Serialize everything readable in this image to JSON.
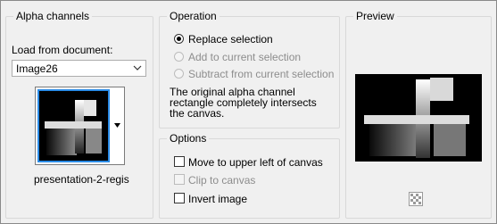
{
  "alpha_group": {
    "title": "Alpha channels",
    "load_label": "Load from document:",
    "document_value": "Image26",
    "channel_name": "presentation-2-regis"
  },
  "operation_group": {
    "title": "Operation",
    "options": [
      {
        "label": "Replace selection",
        "selected": true,
        "enabled": true
      },
      {
        "label": "Add to current selection",
        "selected": false,
        "enabled": false
      },
      {
        "label": "Subtract from current selection",
        "selected": false,
        "enabled": false
      }
    ],
    "description": "The original alpha channel rectangle completely intersects the canvas."
  },
  "options_group": {
    "title": "Options",
    "items": [
      {
        "label": "Move to upper left of canvas",
        "checked": false,
        "enabled": true
      },
      {
        "label": "Clip to canvas",
        "checked": false,
        "enabled": false
      },
      {
        "label": "Invert image",
        "checked": false,
        "enabled": true
      }
    ]
  },
  "preview_group": {
    "title": "Preview",
    "zoom_icon": "checkerboard-zoom-icon"
  },
  "colors": {
    "selection_border": "#2a8be6",
    "group_border": "#d9d9d9",
    "dialog_bg": "#f0f0f0"
  }
}
